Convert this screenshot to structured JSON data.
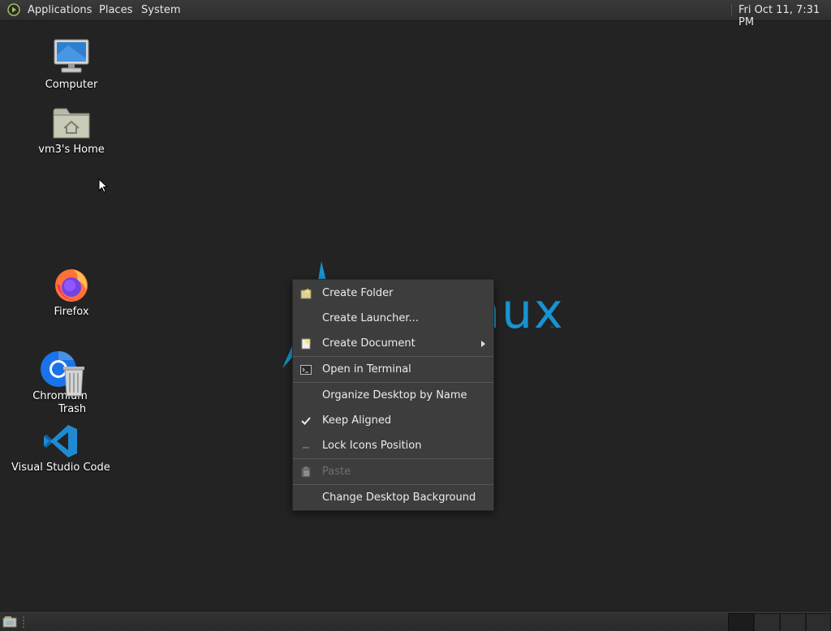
{
  "top_panel": {
    "menus": [
      "Applications",
      "Places",
      "System"
    ],
    "clock": "Fri Oct 11,  7:31 PM"
  },
  "desktop": {
    "icons": [
      {
        "label": "Computer",
        "icon": "computer-icon"
      },
      {
        "label": "vm3's Home",
        "icon": "home-folder-icon"
      },
      {
        "label": "Firefox",
        "icon": "firefox-icon"
      },
      {
        "label": "Chromium",
        "icon": "chromium-icon"
      },
      {
        "label": "Trash",
        "icon": "trash-icon"
      },
      {
        "label": "Visual Studio Code",
        "icon": "vscode-icon"
      }
    ],
    "wallpaper_text": "nux",
    "wallpaper_tm": "™"
  },
  "context_menu": {
    "items": [
      {
        "label": "Create Folder",
        "icon": "new-folder-icon",
        "enabled": true
      },
      {
        "label": "Create Launcher...",
        "icon": "",
        "enabled": true
      },
      {
        "label": "Create Document",
        "icon": "new-document-icon",
        "enabled": true,
        "submenu": true
      },
      {
        "label": "Open in Terminal",
        "icon": "terminal-icon",
        "enabled": true
      },
      {
        "label": "Organize Desktop by Name",
        "icon": "",
        "enabled": true
      },
      {
        "label": "Keep Aligned",
        "icon": "checkmark-icon",
        "enabled": true,
        "checked": true
      },
      {
        "label": "Lock Icons Position",
        "icon": "",
        "enabled": true,
        "checked": false
      },
      {
        "label": "Paste",
        "icon": "paste-icon",
        "enabled": false
      },
      {
        "label": "Change Desktop Background",
        "icon": "",
        "enabled": true
      }
    ]
  },
  "colors": {
    "desktop_bg": "#232323",
    "menu_bg": "#3d3d3d",
    "accent": "#1793d1"
  }
}
